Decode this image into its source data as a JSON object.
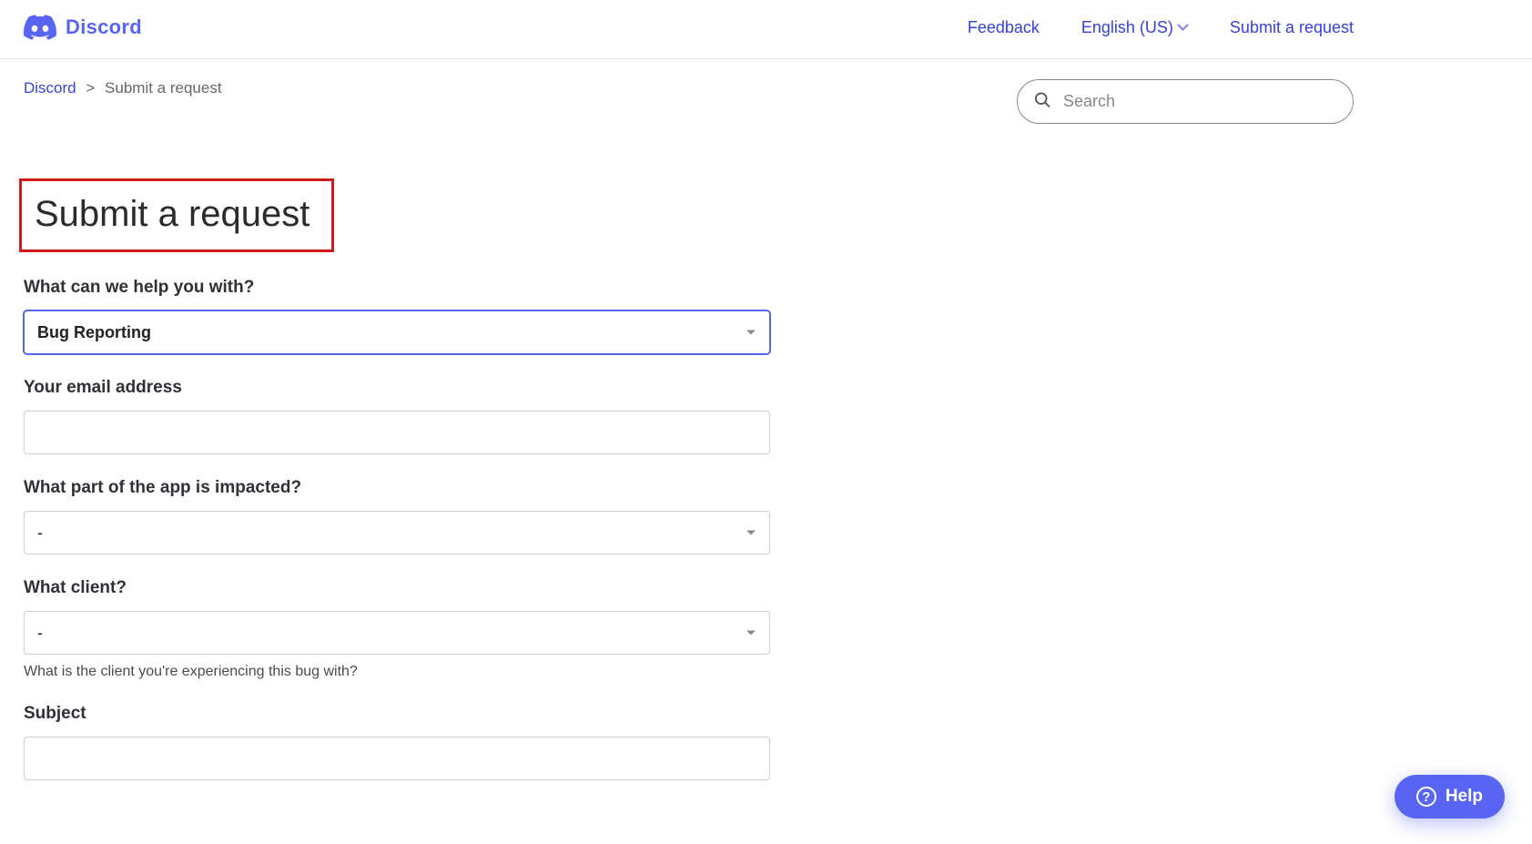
{
  "header": {
    "brand": "Discord",
    "nav": {
      "feedback": "Feedback",
      "language": "English (US)",
      "submit": "Submit a request"
    }
  },
  "breadcrumb": {
    "home": "Discord",
    "current": "Submit a request"
  },
  "search": {
    "placeholder": "Search"
  },
  "page": {
    "title": "Submit a request"
  },
  "form": {
    "helpWith": {
      "label": "What can we help you with?",
      "value": "Bug Reporting"
    },
    "email": {
      "label": "Your email address",
      "value": ""
    },
    "appPart": {
      "label": "What part of the app is impacted?",
      "value": "-"
    },
    "client": {
      "label": "What client?",
      "value": "-",
      "hint": "What is the client you're experiencing this bug with?"
    },
    "subject": {
      "label": "Subject",
      "value": ""
    }
  },
  "helpFab": {
    "label": "Help"
  }
}
